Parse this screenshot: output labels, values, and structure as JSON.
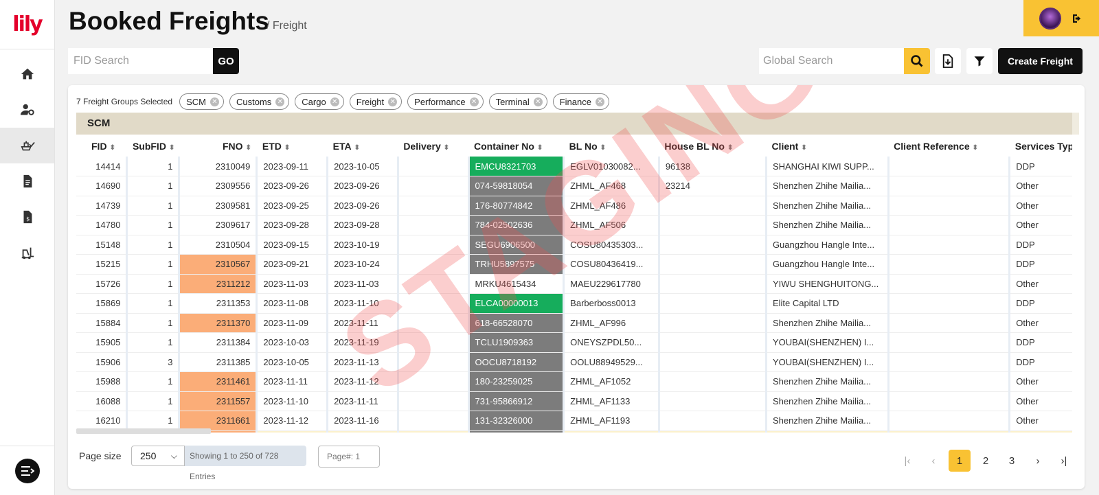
{
  "app": {
    "logo_text": "lily"
  },
  "header": {
    "title": "Booked Freights",
    "breadcrumb": "/ Freight"
  },
  "nav": [
    {
      "name": "nav-home",
      "icon": "home-icon"
    },
    {
      "name": "nav-user-settings",
      "icon": "user-gear-icon"
    },
    {
      "name": "nav-freight",
      "icon": "ship-check-icon",
      "active": true
    },
    {
      "name": "nav-documents",
      "icon": "document-icon"
    },
    {
      "name": "nav-invoices",
      "icon": "invoice-icon"
    },
    {
      "name": "nav-cargo",
      "icon": "forklift-icon"
    }
  ],
  "search": {
    "fid_placeholder": "FID Search",
    "go_label": "GO",
    "global_placeholder": "Global Search",
    "create_label": "Create Freight"
  },
  "filters": {
    "summary": "7 Freight Groups Selected",
    "chips": [
      "SCM",
      "Customs",
      "Cargo",
      "Freight",
      "Performance",
      "Terminal",
      "Finance"
    ]
  },
  "group": {
    "title": "SCM"
  },
  "table": {
    "columns": [
      "FID",
      "SubFID",
      "FNO",
      "ETD",
      "ETA",
      "Delivery",
      "Container No",
      "BL No",
      "House BL No",
      "Client",
      "Client Reference",
      "Services Type"
    ],
    "rows": [
      {
        "fid": "14414",
        "subfid": "1",
        "fno": "2310049",
        "fno_hl": false,
        "etd": "2023-09-11",
        "eta": "2023-10-05",
        "delivery": "",
        "container": "EMCU8321703",
        "container_status": "green",
        "bl": "EGLV01030082...",
        "house_bl": "96138",
        "client": "SHANGHAI KIWI SUPP...",
        "client_ref": "",
        "service": "DDP"
      },
      {
        "fid": "14690",
        "subfid": "1",
        "fno": "2309556",
        "fno_hl": false,
        "etd": "2023-09-26",
        "eta": "2023-09-26",
        "delivery": "",
        "container": "074-59818054",
        "container_status": "grey",
        "bl": "ZHML_AF468",
        "house_bl": "23214",
        "client": "Shenzhen Zhihe Mailia...",
        "client_ref": "",
        "service": "Other"
      },
      {
        "fid": "14739",
        "subfid": "1",
        "fno": "2309581",
        "fno_hl": false,
        "etd": "2023-09-25",
        "eta": "2023-09-26",
        "delivery": "",
        "container": "176-80774842",
        "container_status": "grey",
        "bl": "ZHML_AF486",
        "house_bl": "",
        "client": "Shenzhen Zhihe Mailia...",
        "client_ref": "",
        "service": "Other"
      },
      {
        "fid": "14780",
        "subfid": "1",
        "fno": "2309617",
        "fno_hl": false,
        "etd": "2023-09-28",
        "eta": "2023-09-28",
        "delivery": "",
        "container": "784-02502636",
        "container_status": "grey",
        "bl": "ZHML_AF506",
        "house_bl": "",
        "client": "Shenzhen Zhihe Mailia...",
        "client_ref": "",
        "service": "Other"
      },
      {
        "fid": "15148",
        "subfid": "1",
        "fno": "2310504",
        "fno_hl": false,
        "etd": "2023-09-15",
        "eta": "2023-10-19",
        "delivery": "",
        "container": "SEGU6906500",
        "container_status": "grey",
        "bl": "COSU80435303...",
        "house_bl": "",
        "client": "Guangzhou Hangle Inte...",
        "client_ref": "",
        "service": "DDP"
      },
      {
        "fid": "15215",
        "subfid": "1",
        "fno": "2310567",
        "fno_hl": true,
        "etd": "2023-09-21",
        "eta": "2023-10-24",
        "delivery": "",
        "container": "TRHU5897575",
        "container_status": "grey",
        "bl": "COSU80436419...",
        "house_bl": "",
        "client": "Guangzhou Hangle Inte...",
        "client_ref": "",
        "service": "DDP"
      },
      {
        "fid": "15726",
        "subfid": "1",
        "fno": "2311212",
        "fno_hl": true,
        "etd": "2023-11-03",
        "eta": "2023-11-03",
        "delivery": "",
        "container": "MRKU4615434",
        "container_status": "none",
        "bl": "MAEU229617780",
        "house_bl": "",
        "client": "YIWU SHENGHUITONG...",
        "client_ref": "",
        "service": "Other"
      },
      {
        "fid": "15869",
        "subfid": "1",
        "fno": "2311353",
        "fno_hl": false,
        "etd": "2023-11-08",
        "eta": "2023-11-10",
        "delivery": "",
        "container": "ELCA00000013",
        "container_status": "green",
        "bl": "Barberboss0013",
        "house_bl": "",
        "client": "Elite Capital LTD",
        "client_ref": "",
        "service": "DDP"
      },
      {
        "fid": "15884",
        "subfid": "1",
        "fno": "2311370",
        "fno_hl": true,
        "etd": "2023-11-09",
        "eta": "2023-11-11",
        "delivery": "",
        "container": "618-66528070",
        "container_status": "grey",
        "bl": "ZHML_AF996",
        "house_bl": "",
        "client": "Shenzhen Zhihe Mailia...",
        "client_ref": "",
        "service": "Other"
      },
      {
        "fid": "15905",
        "subfid": "1",
        "fno": "2311384",
        "fno_hl": false,
        "etd": "2023-10-03",
        "eta": "2023-11-19",
        "delivery": "",
        "container": "TCLU1909363",
        "container_status": "grey",
        "bl": "ONEYSZPDL50...",
        "house_bl": "",
        "client": "YOUBAI(SHENZHEN) I...",
        "client_ref": "",
        "service": "DDP"
      },
      {
        "fid": "15906",
        "subfid": "3",
        "fno": "2311385",
        "fno_hl": false,
        "etd": "2023-10-05",
        "eta": "2023-11-13",
        "delivery": "",
        "container": "OOCU8718192",
        "container_status": "grey",
        "bl": "OOLU88949529...",
        "house_bl": "",
        "client": "YOUBAI(SHENZHEN) I...",
        "client_ref": "",
        "service": "DDP"
      },
      {
        "fid": "15988",
        "subfid": "1",
        "fno": "2311461",
        "fno_hl": true,
        "etd": "2023-11-11",
        "eta": "2023-11-12",
        "delivery": "",
        "container": "180-23259025",
        "container_status": "grey",
        "bl": "ZHML_AF1052",
        "house_bl": "",
        "client": "Shenzhen Zhihe Mailia...",
        "client_ref": "",
        "service": "Other"
      },
      {
        "fid": "16088",
        "subfid": "1",
        "fno": "2311557",
        "fno_hl": true,
        "etd": "2023-11-10",
        "eta": "2023-11-11",
        "delivery": "",
        "container": "731-95866912",
        "container_status": "grey",
        "bl": "ZHML_AF1133",
        "house_bl": "",
        "client": "Shenzhen Zhihe Mailia...",
        "client_ref": "",
        "service": "Other"
      },
      {
        "fid": "16210",
        "subfid": "1",
        "fno": "2311661",
        "fno_hl": true,
        "etd": "2023-11-12",
        "eta": "2023-11-16",
        "delivery": "",
        "container": "131-32326000",
        "container_status": "grey",
        "bl": "ZHML_AF1193",
        "house_bl": "",
        "client": "Shenzhen Zhihe Mailia...",
        "client_ref": "",
        "service": "Other"
      }
    ]
  },
  "watermark": "STAGING",
  "footer": {
    "page_size_label": "Page size",
    "page_size_value": "250",
    "showing": "Showing 1 to 250 of 728 Entries",
    "page_input_placeholder": "Page#: 1",
    "pages": [
      "1",
      "2",
      "3"
    ],
    "current_page": "1"
  },
  "colors": {
    "accent": "#f9c233",
    "brand": "#e4002b",
    "green_status": "#16ad5c",
    "grey_status": "#7c7c7c",
    "fno_highlight": "#fbad78",
    "group_bar": "#e1dac8"
  }
}
